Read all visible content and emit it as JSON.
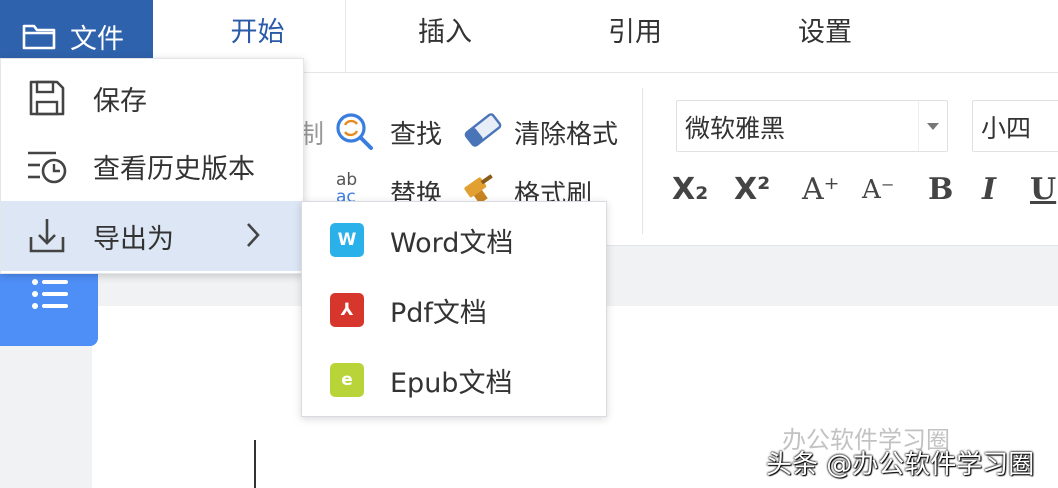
{
  "tabs": {
    "file": "文件",
    "home": "开始",
    "insert": "插入",
    "reference": "引用",
    "settings": "设置"
  },
  "ribbon": {
    "copy_fragment": "制",
    "find": "查找",
    "clear_format": "清除格式",
    "replace": "替换",
    "format_painter": "格式刷",
    "font_name": "微软雅黑",
    "font_size": "小四",
    "replace_icon_top": "ab",
    "replace_icon_bottom": "ac",
    "subscript": "X₂",
    "superscript": "X²",
    "grow_font": "A⁺",
    "shrink_font": "A⁻",
    "bold": "B",
    "italic": "I",
    "underline": "U",
    "accent_color": "#2f62ad"
  },
  "file_menu": {
    "items": [
      {
        "label": "保存",
        "icon": "save-icon"
      },
      {
        "label": "查看历史版本",
        "icon": "history-icon"
      },
      {
        "label": "导出为",
        "icon": "download-icon"
      }
    ]
  },
  "export_submenu": {
    "items": [
      {
        "label": "Word文档",
        "icon": "word-file-icon",
        "color": "#2ab1ea",
        "glyph": "W"
      },
      {
        "label": "Pdf文档",
        "icon": "pdf-file-icon",
        "color": "#d7362d",
        "glyph": "⅄"
      },
      {
        "label": "Epub文档",
        "icon": "epub-file-icon",
        "color": "#b9d438",
        "glyph": "e"
      }
    ]
  },
  "watermark": {
    "line1": "办公软件学习圈",
    "line2": "头条 @办公软件学习圈"
  }
}
